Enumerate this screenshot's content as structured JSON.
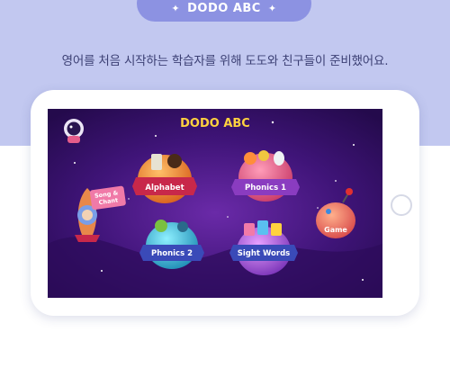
{
  "header": {
    "badge_text": "DODO ABC",
    "subtitle": "영어를 처음 시작하는 학습자를 위해 도도와 친구들이 준비했어요."
  },
  "app": {
    "logo": "DODO ABC",
    "menu": {
      "song_chant": "Song &\nChant",
      "alphabet": "Alphabet",
      "phonics1": "Phonics 1",
      "phonics2": "Phonics 2",
      "sight_words": "Sight Words",
      "game": "Game"
    }
  },
  "colors": {
    "band": "#c2c8f0",
    "badge": "#8c92e2",
    "subtitle_text": "#3c4074",
    "screen_bg": "#3a1370",
    "ribbon_red": "#c8284a",
    "ribbon_purple": "#8a3cc0",
    "ribbon_blue": "#3a4ab8"
  },
  "icons": {
    "sparkle": "sparkle-icon",
    "astronaut": "astronaut-icon",
    "rocket": "rocket-icon",
    "joystick": "joystick-icon"
  }
}
